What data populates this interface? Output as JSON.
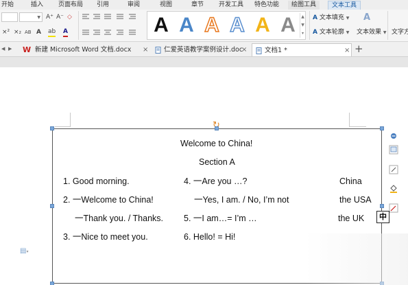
{
  "ribbon_tabs": [
    "开始",
    "插入",
    "页面布局",
    "引用",
    "审阅",
    "视图",
    "章节",
    "开发工具",
    "特色功能",
    "绘图工具",
    "文本工具"
  ],
  "ribbon": {
    "font_size_icons": [
      "A⁺",
      "A⁻"
    ],
    "clear_format": "◇",
    "char_formats": [
      "×²",
      "×₂",
      "AB",
      "A",
      "A"
    ],
    "wordart_letter": "A",
    "text_fill_label": "文本填充",
    "text_outline_label": "文本轮廓",
    "text_effect_label": "文本效果",
    "text_direction_label": "文字方"
  },
  "colors": {
    "wordart": [
      "#111111",
      "#4a86c8",
      "#e8781e",
      "#5a8fcf",
      "#f2b418",
      "#8a8a8a"
    ],
    "accent": "#1a5aa0",
    "wps_red": "#c8201e"
  },
  "doc_tabs": [
    {
      "label": "新建 Microsoft Word 文档.docx",
      "close": "×"
    },
    {
      "label": "仁爱英语教学案例设计.doc",
      "close": "×"
    },
    {
      "label": "文档1 *",
      "close": "×",
      "active": true
    }
  ],
  "new_tab": "+",
  "document": {
    "title": "Welcome to China!",
    "section": "Section A",
    "rows": [
      {
        "left": "1. Good morning.",
        "middle": "4.  一Are you …?",
        "right": "China"
      },
      {
        "left": "2.  一Welcome to China!",
        "middle": "一Yes, I am. / No, I’m not",
        "right": "the USA"
      },
      {
        "left": "一Thank you. / Thanks.",
        "middle": "5.  一I am…= I’m …",
        "right": "the UK"
      },
      {
        "left": "3.  一Nice to meet you.",
        "middle": "6. Hello! = Hi!",
        "right": ""
      }
    ]
  },
  "ime_label": "中"
}
